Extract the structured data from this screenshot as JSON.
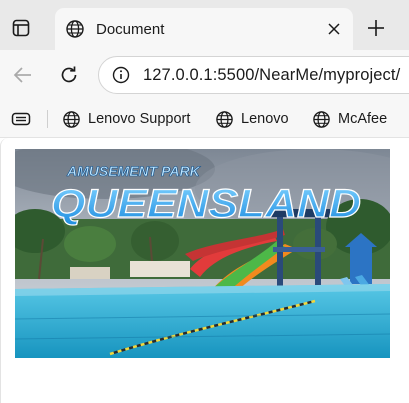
{
  "tab": {
    "title": "Document",
    "icon": "globe-icon"
  },
  "toolbar": {
    "url": "127.0.0.1:5500/NearMe/myproject/"
  },
  "favorites": [
    {
      "label": "Lenovo Support",
      "icon": "globe-icon"
    },
    {
      "label": "Lenovo",
      "icon": "globe-icon"
    },
    {
      "label": "McAfee",
      "icon": "globe-icon"
    }
  ],
  "hero": {
    "subtitle": "AMUSEMENT PARK",
    "title": "QUEENSLAND"
  },
  "colors": {
    "tabstrip": "#e9e9e9",
    "toolbar": "#f7f7f7",
    "title_blue": "#2ea3f2",
    "water": "#32b6dc"
  }
}
